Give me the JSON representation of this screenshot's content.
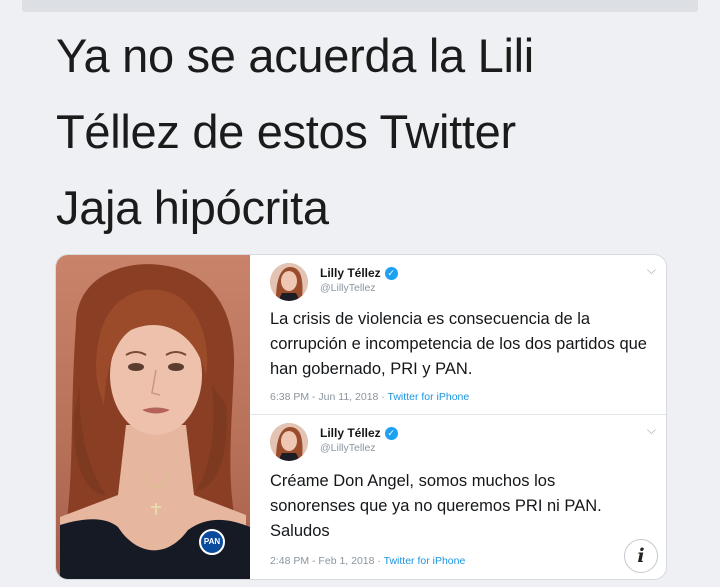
{
  "caption": {
    "lines": [
      "Ya no se acuerda la Lili",
      "Téllez de estos Twitter",
      "Jaja hipócrita"
    ]
  },
  "photo": {
    "badge_text": "PAN"
  },
  "tweets": [
    {
      "name": "Lilly Téllez",
      "handle": "@LillyTellez",
      "text": "La crisis de violencia es consecuencia de la corrupción e incompetencia de los dos partidos que han gobernado, PRI y PAN.",
      "timestamp": "6:38 PM - Jun 11, 2018 · ",
      "client": "Twitter for iPhone"
    },
    {
      "name": "Lilly Téllez",
      "handle": "@LillyTellez",
      "text": "Créame Don Angel, somos muchos los sonorenses que ya no queremos PRI ni PAN. Saludos",
      "timestamp": "2:48 PM - Feb 1, 2018 · ",
      "client": "Twitter for iPhone"
    }
  ],
  "icons": {
    "verified": "verified-check-icon",
    "chevron": "chevron-down-icon",
    "info": "info-icon"
  },
  "info_label": "i",
  "colors": {
    "twitter_blue": "#1da1f2",
    "link_blue": "#1b95e0",
    "muted_gray": "#8a959f"
  }
}
